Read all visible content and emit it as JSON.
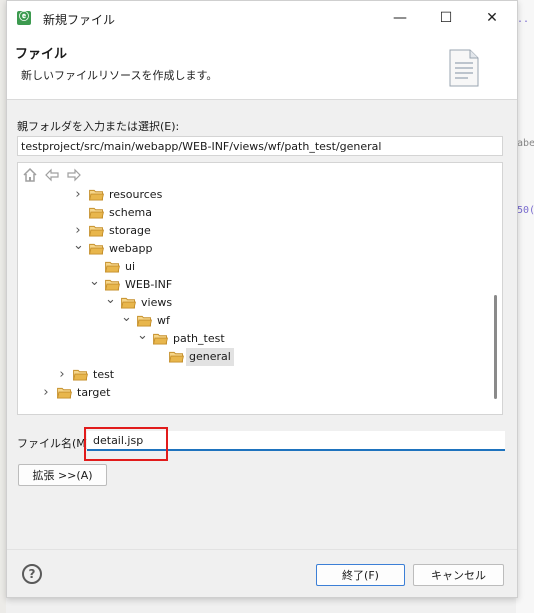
{
  "window": {
    "title": "新規ファイル",
    "minimize_glyph": "—",
    "maximize_glyph": "☐",
    "close_glyph": "✕",
    "app_icon_text": "ⓔ"
  },
  "header": {
    "title": "ファイル",
    "description": "新しいファイルリソースを作成します。"
  },
  "parent_folder": {
    "label": "親フォルダを入力または選択(E):",
    "value": "testproject/src/main/webapp/WEB-INF/views/wf/path_test/general"
  },
  "tree_toolbar": {
    "home_icon": "home-icon",
    "back_icon": "back-arrow-icon",
    "forward_icon": "forward-arrow-icon"
  },
  "tree": [
    {
      "label": "resources",
      "depth": 3,
      "expand": "collapsed"
    },
    {
      "label": "schema",
      "depth": 3,
      "expand": "none"
    },
    {
      "label": "storage",
      "depth": 3,
      "expand": "collapsed"
    },
    {
      "label": "webapp",
      "depth": 3,
      "expand": "expanded"
    },
    {
      "label": "ui",
      "depth": 4,
      "expand": "none"
    },
    {
      "label": "WEB-INF",
      "depth": 4,
      "expand": "expanded"
    },
    {
      "label": "views",
      "depth": 5,
      "expand": "expanded"
    },
    {
      "label": "wf",
      "depth": 6,
      "expand": "expanded"
    },
    {
      "label": "path_test",
      "depth": 7,
      "expand": "expanded"
    },
    {
      "label": "general",
      "depth": 8,
      "expand": "none",
      "selected": true
    },
    {
      "label": "test",
      "depth": 2,
      "expand": "collapsed"
    },
    {
      "label": "target",
      "depth": 1,
      "expand": "collapsed"
    }
  ],
  "file_name": {
    "label": "ファイル名(M):",
    "value": "detail.jsp"
  },
  "buttons": {
    "advanced": "拡張 >>(A)",
    "finish": "終了(F)",
    "cancel": "キャンセル",
    "help": "?"
  },
  "background_text": {
    "top_right": "..",
    "mid_right": "abe",
    "num_right": "50("
  },
  "colors": {
    "highlight": "#e11b1b",
    "accent": "#1e73be",
    "folder": "#e8b64c"
  }
}
